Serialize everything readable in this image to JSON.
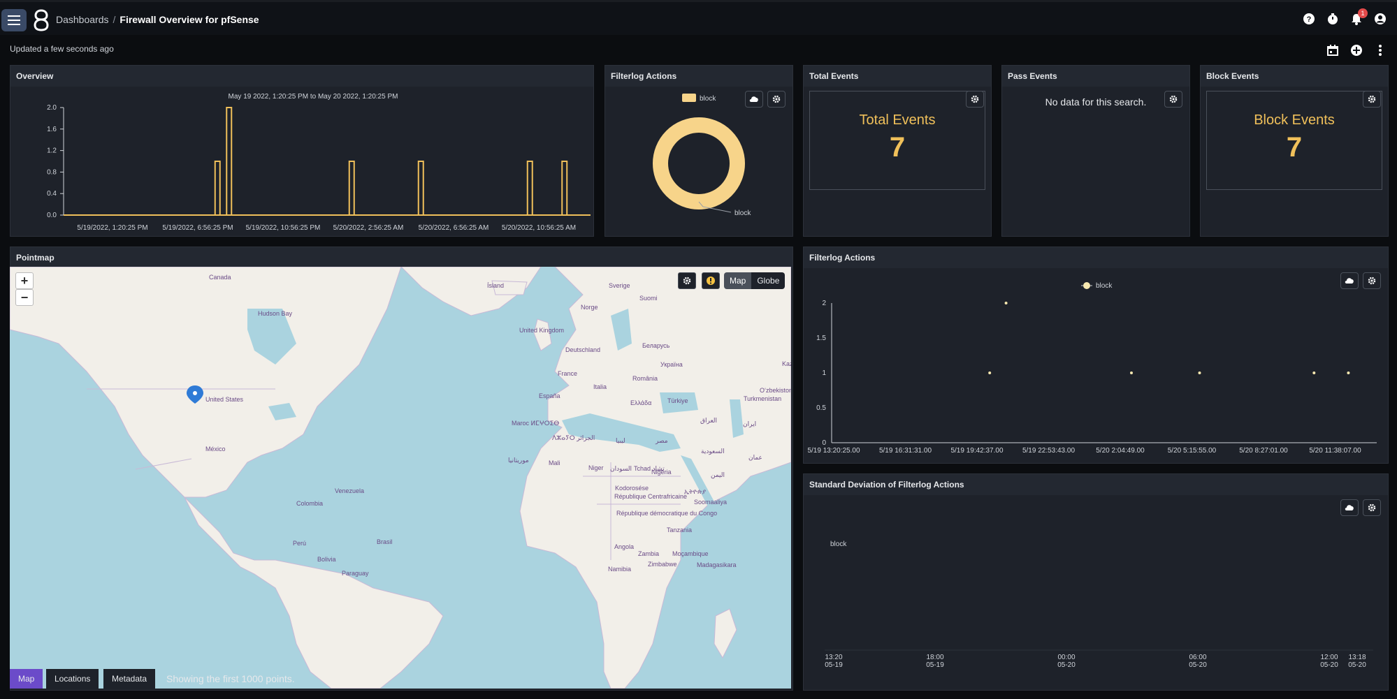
{
  "header": {
    "breadcrumb_root": "Dashboards",
    "breadcrumb_sep": "/",
    "breadcrumb_current": "Firewall Overview for pfSense",
    "notification_count": "1"
  },
  "subheader": {
    "updated": "Updated a few seconds ago"
  },
  "panels": {
    "overview_title": "Overview",
    "filterlog_title": "Filterlog Actions",
    "total_events_title": "Total Events",
    "pass_events_title": "Pass Events",
    "block_events_title": "Block Events",
    "pointmap_title": "Pointmap",
    "filterlog2_title": "Filterlog Actions",
    "stddev_title": "Standard Deviation of Filterlog Actions"
  },
  "stats": {
    "total_label": "Total Events",
    "total_value": "7",
    "pass_nodata": "No data for this search.",
    "block_label": "Block Events",
    "block_value": "7"
  },
  "map": {
    "map_btn": "Map",
    "globe_btn": "Globe",
    "zoom_in": "+",
    "zoom_out": "−",
    "tabs": [
      "Map",
      "Locations",
      "Metadata"
    ],
    "footer_note": "Showing the first 1000 points.",
    "labels": [
      "Canada",
      "United States",
      "México",
      "Venezuela",
      "Colombia",
      "Perú",
      "Bolivia",
      "Brasil",
      "Paraguay",
      "Ísland",
      "Sverige",
      "Suomi",
      "Norge",
      "United Kingdom",
      "Deutschland",
      "Беларусь",
      "Україна",
      "France",
      "Italia",
      "România",
      "España",
      "Ελλάδα",
      "Türkiye",
      "Maroc ⵍⵎⵖⵔⵉⴱ",
      "ⴷⵣⴰⵢⵔ الجزائر",
      "ليبيا",
      "مصر",
      "العراق",
      "ایران",
      "Mali",
      "Niger",
      "Tchad تشاد",
      "السودان",
      "Nigeria",
      "Kodorosése",
      "République Centrafricaine",
      "République démocratique du Congo",
      "Tanzania",
      "Angola",
      "Zambia",
      "Moçambique",
      "Zimbabwe",
      "Namibia",
      "Madagasikara",
      "Soomaaliya",
      "ኢትዮጵያ",
      "Turkmenistan",
      "Oʻzbekiston",
      "Kaz",
      "موريتانيا",
      "السعودية",
      "اليمن",
      "عمان",
      "Hudson Bay"
    ]
  },
  "chart_data": [
    {
      "name": "overview",
      "type": "bar",
      "title": "May 19 2022, 1:20:25 PM to May 20 2022, 1:20:25 PM",
      "xlabel": "",
      "ylabel": "",
      "ylim": [
        0,
        2.0
      ],
      "yticks": [
        "2.0",
        "1.6",
        "1.2",
        "0.8",
        "0.4",
        "0.0"
      ],
      "xticks": [
        "5/19/2022, 1:20:25 PM",
        "5/19/2022, 6:56:25 PM",
        "5/19/2022, 10:56:25 PM",
        "5/20/2022, 2:56:25 AM",
        "5/20/2022, 6:56:25 AM",
        "5/20/2022, 10:56:25 AM"
      ],
      "bars": [
        {
          "x": 0.289,
          "value": 1.0
        },
        {
          "x": 0.311,
          "value": 2.0
        },
        {
          "x": 0.545,
          "value": 1.0
        },
        {
          "x": 0.677,
          "value": 1.0
        },
        {
          "x": 0.885,
          "value": 1.0
        },
        {
          "x": 0.951,
          "value": 1.0
        }
      ],
      "color": "#f0c05a"
    },
    {
      "name": "filterlog_donut",
      "type": "pie",
      "categories": [
        "block"
      ],
      "values": [
        7
      ],
      "legend": "block",
      "color": "#f7d48a"
    },
    {
      "name": "filterlog_scatter",
      "type": "scatter",
      "legend": "block",
      "ylim": [
        0,
        2
      ],
      "yticks": [
        "2",
        "1.5",
        "1",
        "0.5",
        "0"
      ],
      "xticks": [
        "5/19 13:20:25.00",
        "5/19 16:31:31.00",
        "5/19 19:42:37.00",
        "5/19 22:53:43.00",
        "5/20 2:04:49.00",
        "5/20 5:15:55.00",
        "5/20 8:27:01.00",
        "5/20 11:38:07.00"
      ],
      "points": [
        {
          "x": 0.29,
          "y": 1
        },
        {
          "x": 0.32,
          "y": 2
        },
        {
          "x": 0.55,
          "y": 1
        },
        {
          "x": 0.675,
          "y": 1
        },
        {
          "x": 0.885,
          "y": 1
        },
        {
          "x": 0.948,
          "y": 1
        }
      ],
      "color": "#f7e8b0"
    },
    {
      "name": "stddev",
      "type": "line",
      "legend": "block",
      "xticks": [
        [
          "13:20",
          "05-19"
        ],
        [
          "18:00",
          "05-19"
        ],
        [
          "00:00",
          "05-20"
        ],
        [
          "06:00",
          "05-20"
        ],
        [
          "12:00",
          "05-20"
        ],
        [
          "13:18",
          "05-20"
        ]
      ],
      "series": [
        {
          "name": "block",
          "values": []
        }
      ]
    }
  ]
}
